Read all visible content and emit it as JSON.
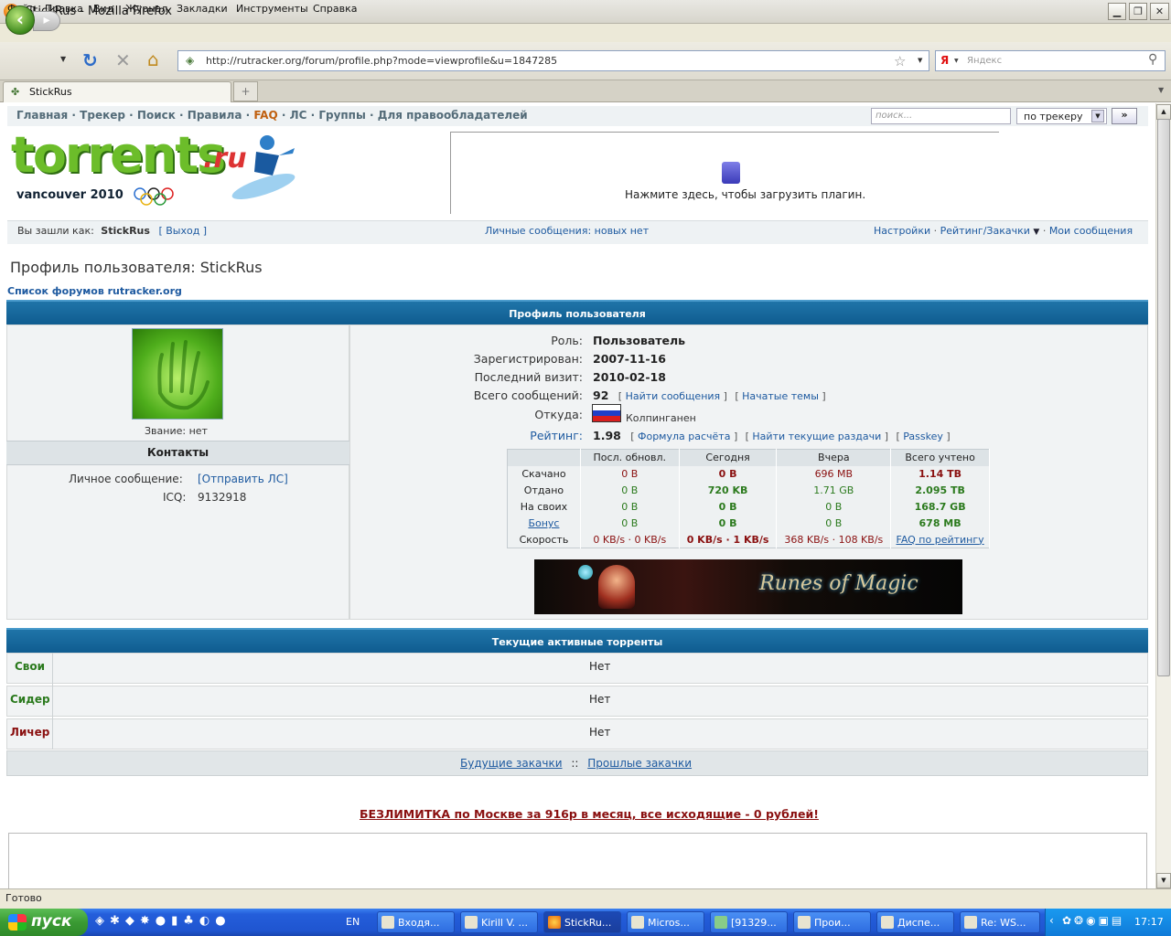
{
  "window": {
    "title": "StickRus - Mozilla Firefox",
    "min": "▁",
    "max": "❐",
    "close": "✕"
  },
  "menu": [
    "Файл",
    "Правка",
    "Вид",
    "Журнал",
    "Закладки",
    "Инструменты",
    "Справка"
  ],
  "nav": {
    "url": "http://rutracker.org/forum/profile.php?mode=viewprofile&u=1847285",
    "search_placeholder": "Яндекс",
    "search_engine_badge": "Я"
  },
  "tabs": [
    {
      "label": "StickRus"
    }
  ],
  "site": {
    "topnav": [
      "Главная",
      "Трекер",
      "Поиск",
      "Правила",
      "FAQ",
      "ЛС",
      "Группы",
      "Для правообладателей"
    ],
    "topnav_sep": "·",
    "search_placeholder": "поиск...",
    "search_scope": "по трекеру",
    "search_go": "»",
    "logo_text": "torrents",
    "logo_suffix": ".ru",
    "logo_sub": "vancouver 2010",
    "plugin_text": "Нажмите здесь, чтобы загрузить плагин.",
    "logged_in_prefix": "Вы зашли как:",
    "username": "StickRus",
    "logout": "Выход",
    "pm_status": "Личные сообщения: новых нет",
    "settings": "Настройки",
    "rating_downloads": "Рейтинг/Закачки",
    "my_posts": "Мои сообщения",
    "page_title": "Профиль пользователя: StickRus",
    "breadcrumb": "Список форумов rutracker.org"
  },
  "profile": {
    "header": "Профиль пользователя",
    "rank_label": "Звание:",
    "rank_value": "нет",
    "contacts_header": "Контакты",
    "pm_label": "Личное сообщение:",
    "pm_link": "[Отправить ЛС]",
    "icq_label": "ICQ:",
    "icq_value": "9132918",
    "role_label": "Роль:",
    "role_value": "Пользователь",
    "registered_label": "Зарегистрирован:",
    "registered_value": "2007-11-16",
    "last_visit_label": "Последний визит:",
    "last_visit_value": "2010-02-18",
    "posts_label": "Всего сообщений:",
    "posts_value": "92",
    "find_posts": "Найти сообщения",
    "started_topics": "Начатые темы",
    "from_label": "Откуда:",
    "from_value": "Колпинганен",
    "rating_label": "Рейтинг:",
    "rating_value": "1.98",
    "rating_formula": "Формула расчёта",
    "find_releases": "Найти текущие раздачи",
    "passkey": "Passkey"
  },
  "stats": {
    "columns": [
      "",
      "Посл. обновл.",
      "Сегодня",
      "Вчера",
      "Всего учтено"
    ],
    "rows": [
      [
        "Скачано",
        "0 B",
        "0 B",
        "696 MB",
        "1.14 TB"
      ],
      [
        "Отдано",
        "0 B",
        "720 KB",
        "1.71 GB",
        "2.095 TB"
      ],
      [
        "На своих",
        "0 B",
        "0 B",
        "0 B",
        "168.7 GB"
      ],
      [
        "Бонус",
        "0 B",
        "0 B",
        "0 B",
        "678 MB"
      ]
    ],
    "speed_label": "Скорость",
    "speed_last": "0 KB/s · 0 KB/s",
    "speed_today": "0 KB/s · 1 KB/s",
    "speed_yesterday": "368 KB/s · 108 KB/s",
    "faq_link": "FAQ по рейтингу"
  },
  "banner": {
    "text": "Runes of Magic"
  },
  "active": {
    "header": "Текущие активные торренты",
    "rows": [
      {
        "label": "Свои",
        "value": "Нет"
      },
      {
        "label": "Сидер",
        "value": "Нет"
      },
      {
        "label": "Личер",
        "value": "Нет"
      }
    ],
    "future": "Будущие закачки",
    "sep": "::",
    "past": "Прошлые закачки"
  },
  "ad_text": "БЕЗЛИМИТКА по Москве за 916р в месяц, все исходящие - 0 рублей!",
  "status": "Готово",
  "taskbar": {
    "start": "пуск",
    "lang": "EN",
    "tasks": [
      "Входя...",
      "Kirill V. ...",
      "StickRu...",
      "Micros...",
      "[91329...",
      "Прои...",
      "Диспе...",
      "Re: WS..."
    ],
    "clock": "17:17"
  },
  "colors": {
    "accent": "#0f5c90",
    "link": "#1e5aa0",
    "green": "#2b7a1d",
    "red": "#8a1010"
  }
}
